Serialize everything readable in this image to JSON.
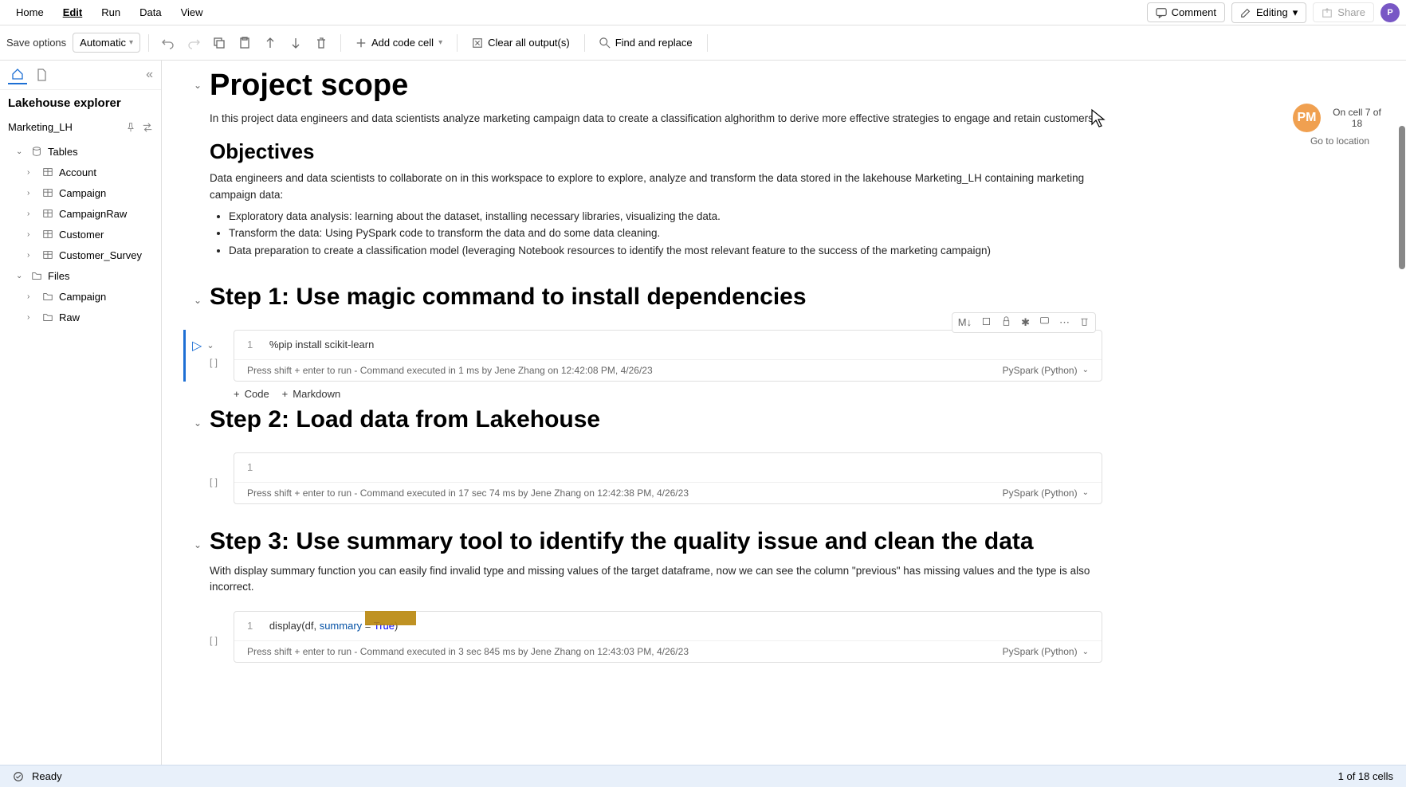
{
  "menubar": {
    "items": [
      "Home",
      "Edit",
      "Run",
      "Data",
      "View"
    ],
    "active_idx": 1,
    "comment": "Comment",
    "editing": "Editing",
    "share": "Share"
  },
  "toolbar": {
    "save_label": "Save options",
    "save_mode": "Automatic",
    "add_code": "Add code cell",
    "clear_output": "Clear all output(s)",
    "find_replace": "Find and replace"
  },
  "sidebar": {
    "title": "Lakehouse explorer",
    "lakehouse": "Marketing_LH",
    "nodes": [
      {
        "label": "Tables",
        "depth": 0,
        "expanded": true,
        "icon": "db"
      },
      {
        "label": "Account",
        "depth": 1,
        "icon": "table"
      },
      {
        "label": "Campaign",
        "depth": 1,
        "icon": "table"
      },
      {
        "label": "CampaignRaw",
        "depth": 1,
        "icon": "table"
      },
      {
        "label": "Customer",
        "depth": 1,
        "icon": "table"
      },
      {
        "label": "Customer_Survey",
        "depth": 1,
        "icon": "table"
      },
      {
        "label": "Files",
        "depth": 0,
        "expanded": true,
        "icon": "folder"
      },
      {
        "label": "Campaign",
        "depth": 1,
        "icon": "folder"
      },
      {
        "label": "Raw",
        "depth": 1,
        "icon": "folder"
      }
    ]
  },
  "notebook": {
    "md1": {
      "title": "Project scope",
      "intro": "In this project data engineers and data scientists analyze marketing campaign data to create a classification alghorithm to derive more effective strategies to engage and retain customers.",
      "obj_title": "Objectives",
      "obj_intro": "Data engineers and data scientists to collaborate on in this workspace to explore to explore, analyze and transform the data stored in the lakehouse Marketing_LH containing marketing campaign data:",
      "bullets": [
        "Exploratory data analysis: learning about the dataset, installing necessary libraries, visualizing the data.",
        "Transform the data: Using PySpark code to transform the data and do some data cleaning.",
        "Data preparation to create a classification model (leveraging Notebook resources to identify the most relevant feature to the success of the marketing campaign)"
      ]
    },
    "step1": {
      "title": "Step 1: Use magic command to install dependencies",
      "code": "%pip install scikit-learn",
      "hint": "Press shift + enter to run",
      "status": "Command executed in 1 ms by Jene Zhang on 12:42:08 PM, 4/26/23",
      "lang": "PySpark (Python)"
    },
    "step2": {
      "title": "Step 2: Load data from Lakehouse",
      "hint": "Press shift + enter to run",
      "status": "Command executed in 17 sec 74 ms by Jene Zhang on 12:42:38 PM, 4/26/23",
      "lang": "PySpark (Python)"
    },
    "step3": {
      "title": "Step 3: Use summary tool to identify the quality issue and clean the data",
      "desc": "With display summary function you can easily find invalid type and missing values of the target dataframe, now we can see the column \"previous\" has missing values and the type is also incorrect.",
      "code_pre": "display(df, ",
      "code_kw": "summary",
      "code_eq": " = ",
      "code_val": "True",
      "code_post": ")",
      "hint": "Press shift + enter to run",
      "status": "Command executed in 3 sec 845 ms by Jene Zhang on 12:43:03 PM, 4/26/23",
      "lang": "PySpark (Python)"
    },
    "add_code": "Code",
    "add_md": "Markdown"
  },
  "collab": {
    "initials": "PM",
    "status": "On cell 7 of 18",
    "goto": "Go to location"
  },
  "status": {
    "ready": "Ready",
    "cells": "1 of 18 cells"
  },
  "cell_toolbar": {
    "md": "M↓"
  }
}
